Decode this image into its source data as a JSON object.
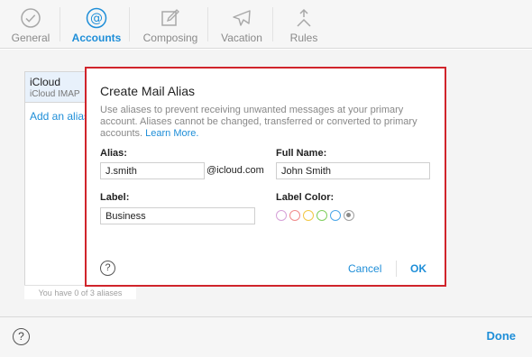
{
  "toolbar": {
    "items": [
      {
        "label": "General",
        "icon": "checkmark-circle-icon"
      },
      {
        "label": "Accounts",
        "icon": "at-sign-icon",
        "active": true
      },
      {
        "label": "Composing",
        "icon": "compose-icon"
      },
      {
        "label": "Vacation",
        "icon": "airplane-icon"
      },
      {
        "label": "Rules",
        "icon": "rules-arrows-icon"
      }
    ]
  },
  "accounts": {
    "selected_name": "iCloud",
    "selected_sub": "iCloud IMAP",
    "add_label": "Add an alias...",
    "count_text": "You have 0 of 3 aliases"
  },
  "footer": {
    "help": "?",
    "done_label": "Done"
  },
  "dialog": {
    "title": "Create Mail Alias",
    "description": "Use aliases to prevent receiving unwanted messages at your primary account. Aliases cannot be changed, transferred or converted to primary accounts.",
    "learn_more": "Learn More.",
    "alias_label": "Alias:",
    "alias_value": "J.smith",
    "alias_suffix": "@icloud.com",
    "fullname_label": "Full Name:",
    "fullname_value": "John Smith",
    "label_label": "Label:",
    "label_value": "Business",
    "color_label": "Label Color:",
    "colors": [
      "#d6a0d8",
      "#f08a8a",
      "#f2c744",
      "#7fcf5c",
      "#4aa6e8",
      "#a0a0a0"
    ],
    "selected_color_index": 5,
    "help": "?",
    "cancel_label": "Cancel",
    "ok_label": "OK"
  },
  "colors": {
    "accent": "#1e8ed8",
    "highlight_border": "#d0242b"
  }
}
